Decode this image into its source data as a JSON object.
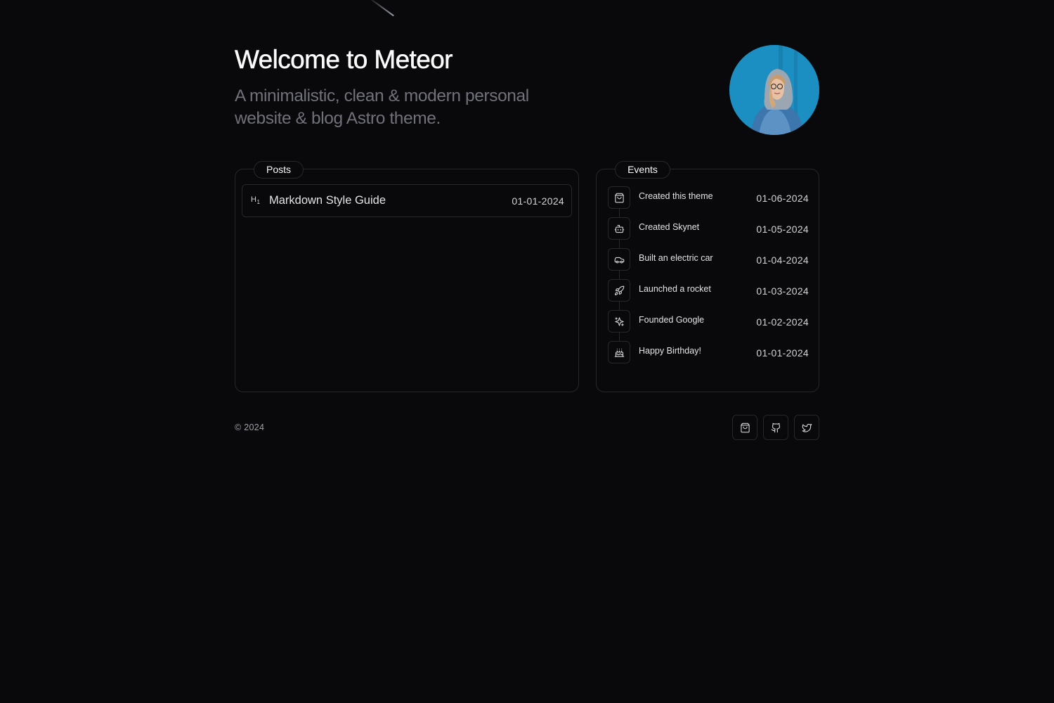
{
  "hero": {
    "title": "Welcome to Meteor",
    "subtitle": "A minimalistic, clean & modern personal website & blog Astro theme."
  },
  "posts": {
    "heading": "Posts",
    "items": [
      {
        "icon": "heading-1-icon",
        "icon_text": "H",
        "icon_sub": "1",
        "title": "Markdown Style Guide",
        "date": "01-01-2024"
      }
    ]
  },
  "events": {
    "heading": "Events",
    "items": [
      {
        "icon": "shopping-bag-icon",
        "label": "Created this theme",
        "date": "01-06-2024"
      },
      {
        "icon": "bot-icon",
        "label": "Created Skynet",
        "date": "01-05-2024"
      },
      {
        "icon": "car-icon",
        "label": "Built an electric car",
        "date": "01-04-2024"
      },
      {
        "icon": "rocket-icon",
        "label": "Launched a rocket",
        "date": "01-03-2024"
      },
      {
        "icon": "sparkles-icon",
        "label": "Founded Google",
        "date": "01-02-2024"
      },
      {
        "icon": "cake-icon",
        "label": "Happy Birthday!",
        "date": "01-01-2024"
      }
    ]
  },
  "footer": {
    "copyright": "© 2024",
    "social": [
      {
        "icon": "shopping-bag-icon"
      },
      {
        "icon": "github-icon"
      },
      {
        "icon": "twitter-icon"
      }
    ]
  }
}
